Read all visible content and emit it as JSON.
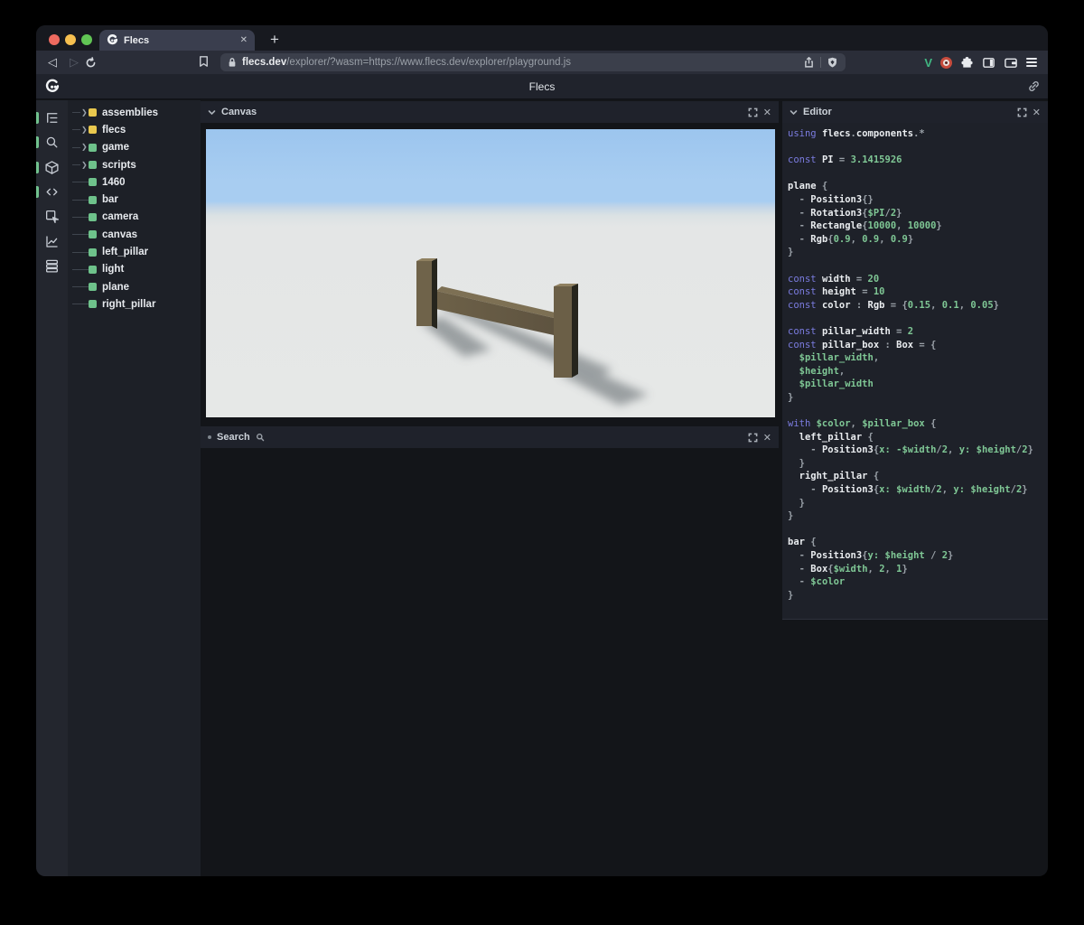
{
  "browser": {
    "tab_title": "Flecs",
    "new_tab_label": "+",
    "url_domain": "flecs.dev",
    "url_path": "/explorer/?wasm=https://www.flecs.dev/explorer/playground.js",
    "traffic_lights": [
      "#ee6a5f",
      "#f5bf4f",
      "#61c554"
    ],
    "close_glyph": "✕"
  },
  "header": {
    "title": "Flecs"
  },
  "sidebar": {
    "icons": [
      {
        "name": "tree-view-icon",
        "active": true
      },
      {
        "name": "search-icon",
        "active": true
      },
      {
        "name": "entities-cube-icon",
        "active": true
      },
      {
        "name": "code-icon",
        "active": true
      },
      {
        "name": "inspector-icon",
        "active": false
      },
      {
        "name": "stats-chart-icon",
        "active": false
      },
      {
        "name": "queries-list-icon",
        "active": false
      }
    ]
  },
  "tree": {
    "colors": {
      "yellow": "#e9c84e",
      "green": "#6ec28b"
    },
    "items": [
      {
        "label": "assemblies",
        "color": "yellow",
        "expandable": true
      },
      {
        "label": "flecs",
        "color": "yellow",
        "expandable": true
      },
      {
        "label": "game",
        "color": "green",
        "expandable": true
      },
      {
        "label": "scripts",
        "color": "green",
        "expandable": true
      },
      {
        "label": "1460",
        "color": "green",
        "expandable": false
      },
      {
        "label": "bar",
        "color": "green",
        "expandable": false
      },
      {
        "label": "camera",
        "color": "green",
        "expandable": false
      },
      {
        "label": "canvas",
        "color": "green",
        "expandable": false
      },
      {
        "label": "left_pillar",
        "color": "green",
        "expandable": false
      },
      {
        "label": "light",
        "color": "green",
        "expandable": false
      },
      {
        "label": "plane",
        "color": "green",
        "expandable": false
      },
      {
        "label": "right_pillar",
        "color": "green",
        "expandable": false
      }
    ]
  },
  "panels": {
    "canvas": {
      "title": "Canvas"
    },
    "search": {
      "title": "Search"
    },
    "editor": {
      "title": "Editor"
    }
  },
  "code": {
    "lines": [
      [
        [
          "k",
          "using "
        ],
        [
          "i",
          "flecs"
        ],
        [
          "p",
          "."
        ],
        [
          "i",
          "components"
        ],
        [
          "p",
          ".*"
        ]
      ],
      [],
      [
        [
          "k",
          "const "
        ],
        [
          "i",
          "PI"
        ],
        [
          "p",
          " = "
        ],
        [
          "n",
          "3.1415926"
        ]
      ],
      [],
      [
        [
          "i",
          "plane"
        ],
        [
          "p",
          " {"
        ]
      ],
      [
        [
          "p",
          "  - "
        ],
        [
          "i",
          "Position3"
        ],
        [
          "p",
          "{}"
        ]
      ],
      [
        [
          "p",
          "  - "
        ],
        [
          "i",
          "Rotation3"
        ],
        [
          "p",
          "{"
        ],
        [
          "n",
          "$PI"
        ],
        [
          "p",
          "/"
        ],
        [
          "n",
          "2"
        ],
        [
          "p",
          "}"
        ]
      ],
      [
        [
          "p",
          "  - "
        ],
        [
          "i",
          "Rectangle"
        ],
        [
          "p",
          "{"
        ],
        [
          "n",
          "10000"
        ],
        [
          "p",
          ", "
        ],
        [
          "n",
          "10000"
        ],
        [
          "p",
          "}"
        ]
      ],
      [
        [
          "p",
          "  - "
        ],
        [
          "i",
          "Rgb"
        ],
        [
          "p",
          "{"
        ],
        [
          "n",
          "0.9"
        ],
        [
          "p",
          ", "
        ],
        [
          "n",
          "0.9"
        ],
        [
          "p",
          ", "
        ],
        [
          "n",
          "0.9"
        ],
        [
          "p",
          "}"
        ]
      ],
      [
        [
          "p",
          "}"
        ]
      ],
      [],
      [
        [
          "k",
          "const "
        ],
        [
          "i",
          "width"
        ],
        [
          "p",
          " = "
        ],
        [
          "n",
          "20"
        ]
      ],
      [
        [
          "k",
          "const "
        ],
        [
          "i",
          "height"
        ],
        [
          "p",
          " = "
        ],
        [
          "n",
          "10"
        ]
      ],
      [
        [
          "k",
          "const "
        ],
        [
          "i",
          "color"
        ],
        [
          "p",
          " : "
        ],
        [
          "i",
          "Rgb"
        ],
        [
          "p",
          " = {"
        ],
        [
          "n",
          "0.15"
        ],
        [
          "p",
          ", "
        ],
        [
          "n",
          "0.1"
        ],
        [
          "p",
          ", "
        ],
        [
          "n",
          "0.05"
        ],
        [
          "p",
          "}"
        ]
      ],
      [],
      [
        [
          "k",
          "const "
        ],
        [
          "i",
          "pillar_width"
        ],
        [
          "p",
          " = "
        ],
        [
          "n",
          "2"
        ]
      ],
      [
        [
          "k",
          "const "
        ],
        [
          "i",
          "pillar_box"
        ],
        [
          "p",
          " : "
        ],
        [
          "i",
          "Box"
        ],
        [
          "p",
          " = {"
        ]
      ],
      [
        [
          "n",
          "  $pillar_width"
        ],
        [
          "p",
          ","
        ]
      ],
      [
        [
          "n",
          "  $height"
        ],
        [
          "p",
          ","
        ]
      ],
      [
        [
          "n",
          "  $pillar_width"
        ]
      ],
      [
        [
          "p",
          "}"
        ]
      ],
      [],
      [
        [
          "k",
          "with "
        ],
        [
          "n",
          "$color"
        ],
        [
          "p",
          ", "
        ],
        [
          "n",
          "$pillar_box"
        ],
        [
          "p",
          " {"
        ]
      ],
      [
        [
          "i",
          "  left_pillar"
        ],
        [
          "p",
          " {"
        ]
      ],
      [
        [
          "p",
          "    - "
        ],
        [
          "i",
          "Position3"
        ],
        [
          "p",
          "{"
        ],
        [
          "n",
          "x: -$width"
        ],
        [
          "p",
          "/"
        ],
        [
          "n",
          "2"
        ],
        [
          "p",
          ", "
        ],
        [
          "n",
          "y: $height"
        ],
        [
          "p",
          "/"
        ],
        [
          "n",
          "2"
        ],
        [
          "p",
          "}"
        ]
      ],
      [
        [
          "p",
          "  }"
        ]
      ],
      [
        [
          "i",
          "  right_pillar"
        ],
        [
          "p",
          " {"
        ]
      ],
      [
        [
          "p",
          "    - "
        ],
        [
          "i",
          "Position3"
        ],
        [
          "p",
          "{"
        ],
        [
          "n",
          "x: $width"
        ],
        [
          "p",
          "/"
        ],
        [
          "n",
          "2"
        ],
        [
          "p",
          ", "
        ],
        [
          "n",
          "y: $height"
        ],
        [
          "p",
          "/"
        ],
        [
          "n",
          "2"
        ],
        [
          "p",
          "}"
        ]
      ],
      [
        [
          "p",
          "  }"
        ]
      ],
      [
        [
          "p",
          "}"
        ]
      ],
      [],
      [
        [
          "i",
          "bar"
        ],
        [
          "p",
          " {"
        ]
      ],
      [
        [
          "p",
          "  - "
        ],
        [
          "i",
          "Position3"
        ],
        [
          "p",
          "{"
        ],
        [
          "n",
          "y: $height"
        ],
        [
          "p",
          " / "
        ],
        [
          "n",
          "2"
        ],
        [
          "p",
          "}"
        ]
      ],
      [
        [
          "p",
          "  - "
        ],
        [
          "i",
          "Box"
        ],
        [
          "p",
          "{"
        ],
        [
          "n",
          "$width"
        ],
        [
          "p",
          ", "
        ],
        [
          "n",
          "2"
        ],
        [
          "p",
          ", "
        ],
        [
          "n",
          "1"
        ],
        [
          "p",
          "}"
        ]
      ],
      [
        [
          "p",
          "  - "
        ],
        [
          "n",
          "$color"
        ]
      ],
      [
        [
          "p",
          "}"
        ]
      ]
    ]
  },
  "scene": {
    "sky": "#9cc5ee",
    "sky_low": "#a8cdf1",
    "ground": "#e4e6e6",
    "wood_front": "#6b5f47",
    "wood_front_light": "#6f634a",
    "wood_side": "#26251d",
    "wood_top": "#8f8060",
    "bar_top": "#7d7054",
    "bar_front": "#665a42",
    "shadow": "#878d90"
  }
}
